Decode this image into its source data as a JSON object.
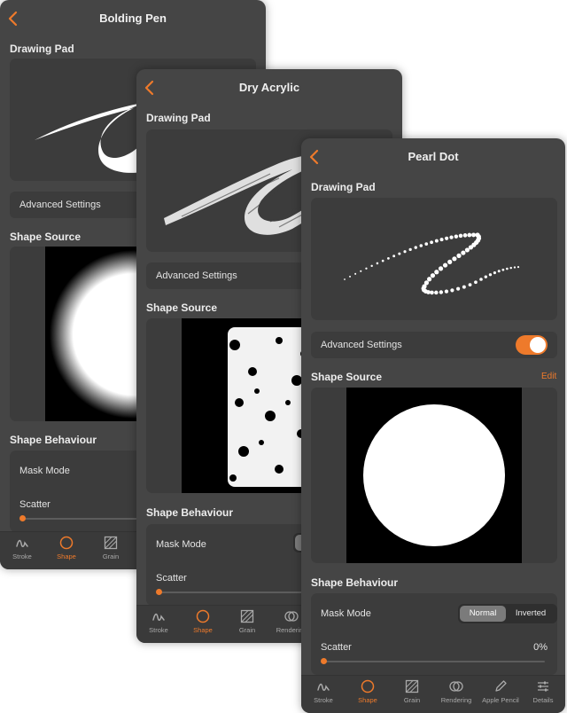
{
  "accent": "#ee7a2b",
  "panels": {
    "bolding_pen": {
      "title": "Bolding Pen",
      "drawing_pad_label": "Drawing Pad",
      "advanced_label": "Advanced Settings",
      "shape_source_label": "Shape Source",
      "shape_behaviour_label": "Shape Behaviour",
      "mask_mode_label": "Mask Mode",
      "scatter_label": "Scatter",
      "tabs": [
        "Stroke",
        "Shape",
        "Grain"
      ]
    },
    "dry_acrylic": {
      "title": "Dry Acrylic",
      "drawing_pad_label": "Drawing Pad",
      "advanced_label": "Advanced Settings",
      "shape_source_label": "Shape Source",
      "shape_behaviour_label": "Shape Behaviour",
      "mask_mode_label": "Mask Mode",
      "mask_mode_partial": "N",
      "scatter_label": "Scatter",
      "tabs": [
        "Stroke",
        "Shape",
        "Grain",
        "Rendering"
      ]
    },
    "pearl_dot": {
      "title": "Pearl Dot",
      "drawing_pad_label": "Drawing Pad",
      "advanced_label": "Advanced Settings",
      "advanced_enabled": true,
      "shape_source_label": "Shape Source",
      "edit_label": "Edit",
      "shape_behaviour_label": "Shape Behaviour",
      "mask_mode_label": "Mask Mode",
      "mask_options": [
        "Normal",
        "Inverted"
      ],
      "mask_selected": "Normal",
      "scatter_label": "Scatter",
      "scatter_value": "0%",
      "scatter_fraction": 0,
      "tabs": [
        "Stroke",
        "Shape",
        "Grain",
        "Rendering",
        "Apple Pencil",
        "Details"
      ]
    }
  },
  "active_tab": "Shape"
}
